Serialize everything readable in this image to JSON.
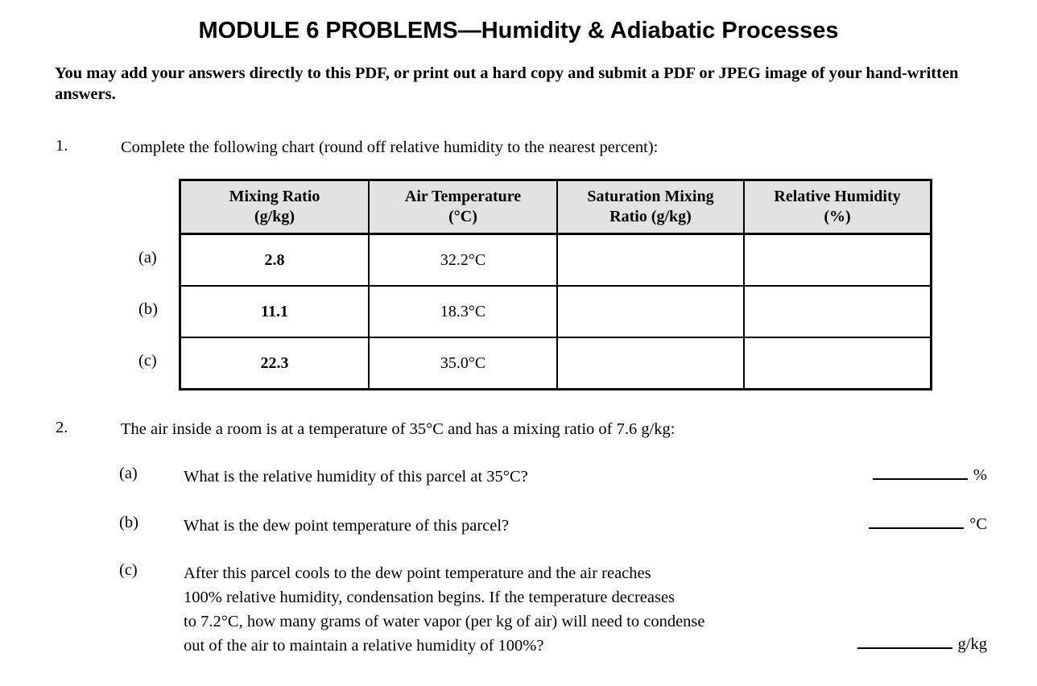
{
  "document": {
    "title": "MODULE 6 PROBLEMS—Humidity & Adiabatic Processes",
    "intro": "You may add your answers directly to this PDF, or print out a hard copy and submit a PDF or JPEG image of your hand-written answers."
  },
  "question1": {
    "number": "1.",
    "prompt": "Complete the following chart (round off relative humidity to the nearest percent):",
    "table": {
      "headers": [
        "Mixing Ratio\n(g/kg)",
        "Air Temperature\n(°C)",
        "Saturation Mixing\nRatio (g/kg)",
        "Relative Humidity\n(%)"
      ],
      "headers_split": [
        {
          "line1": "Mixing Ratio",
          "line2": "(g/kg)"
        },
        {
          "line1": "Air Temperature",
          "line2": "(°C)"
        },
        {
          "line1": "Saturation Mixing",
          "line2": "Ratio (g/kg)"
        },
        {
          "line1": "Relative Humidity",
          "line2": "(%)"
        }
      ],
      "rows": [
        {
          "tag": "(a)",
          "mixing_ratio": "2.8",
          "air_temperature": "32.2°C",
          "saturation_mixing_ratio": "",
          "relative_humidity": ""
        },
        {
          "tag": "(b)",
          "mixing_ratio": "11.1",
          "air_temperature": "18.3°C",
          "saturation_mixing_ratio": "",
          "relative_humidity": ""
        },
        {
          "tag": "(c)",
          "mixing_ratio": "22.3",
          "air_temperature": "35.0°C",
          "saturation_mixing_ratio": "",
          "relative_humidity": ""
        }
      ]
    }
  },
  "question2": {
    "number": "2.",
    "prompt": "The air inside a room is at a temperature of 35°C and has a mixing ratio of 7.6 g/kg:",
    "parts": [
      {
        "tag": "(a)",
        "lines": [
          "What is the relative humidity of this parcel at 35°C?"
        ],
        "answer_value": "",
        "answer_unit": "%"
      },
      {
        "tag": "(b)",
        "lines": [
          "What is the dew point temperature of this parcel?"
        ],
        "answer_value": "",
        "answer_unit": "°C"
      },
      {
        "tag": "(c)",
        "lines": [
          "After this parcel cools to the dew point temperature and the air reaches",
          "100% relative humidity, condensation begins.  If the temperature decreases",
          "to 7.2°C, how many grams of water vapor (per kg of air) will need to condense",
          "out of the air to maintain a relative humidity of 100%?"
        ],
        "answer_value": "",
        "answer_unit": "g/kg"
      }
    ]
  },
  "colors": {
    "page_background": "#ffffff",
    "text": "#000000",
    "table_shading": "#e2e2e2",
    "table_border": "#000000"
  }
}
